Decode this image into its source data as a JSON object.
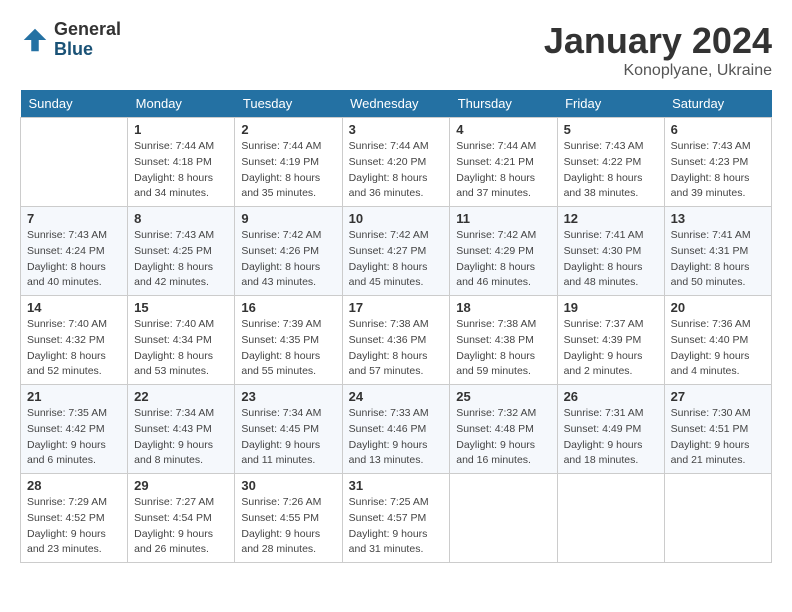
{
  "logo": {
    "general": "General",
    "blue": "Blue"
  },
  "title": {
    "month": "January 2024",
    "location": "Konoplyane, Ukraine"
  },
  "weekdays": [
    "Sunday",
    "Monday",
    "Tuesday",
    "Wednesday",
    "Thursday",
    "Friday",
    "Saturday"
  ],
  "weeks": [
    [
      {
        "day": "",
        "sunrise": "",
        "sunset": "",
        "daylight": ""
      },
      {
        "day": "1",
        "sunrise": "Sunrise: 7:44 AM",
        "sunset": "Sunset: 4:18 PM",
        "daylight": "Daylight: 8 hours and 34 minutes."
      },
      {
        "day": "2",
        "sunrise": "Sunrise: 7:44 AM",
        "sunset": "Sunset: 4:19 PM",
        "daylight": "Daylight: 8 hours and 35 minutes."
      },
      {
        "day": "3",
        "sunrise": "Sunrise: 7:44 AM",
        "sunset": "Sunset: 4:20 PM",
        "daylight": "Daylight: 8 hours and 36 minutes."
      },
      {
        "day": "4",
        "sunrise": "Sunrise: 7:44 AM",
        "sunset": "Sunset: 4:21 PM",
        "daylight": "Daylight: 8 hours and 37 minutes."
      },
      {
        "day": "5",
        "sunrise": "Sunrise: 7:43 AM",
        "sunset": "Sunset: 4:22 PM",
        "daylight": "Daylight: 8 hours and 38 minutes."
      },
      {
        "day": "6",
        "sunrise": "Sunrise: 7:43 AM",
        "sunset": "Sunset: 4:23 PM",
        "daylight": "Daylight: 8 hours and 39 minutes."
      }
    ],
    [
      {
        "day": "7",
        "sunrise": "Sunrise: 7:43 AM",
        "sunset": "Sunset: 4:24 PM",
        "daylight": "Daylight: 8 hours and 40 minutes."
      },
      {
        "day": "8",
        "sunrise": "Sunrise: 7:43 AM",
        "sunset": "Sunset: 4:25 PM",
        "daylight": "Daylight: 8 hours and 42 minutes."
      },
      {
        "day": "9",
        "sunrise": "Sunrise: 7:42 AM",
        "sunset": "Sunset: 4:26 PM",
        "daylight": "Daylight: 8 hours and 43 minutes."
      },
      {
        "day": "10",
        "sunrise": "Sunrise: 7:42 AM",
        "sunset": "Sunset: 4:27 PM",
        "daylight": "Daylight: 8 hours and 45 minutes."
      },
      {
        "day": "11",
        "sunrise": "Sunrise: 7:42 AM",
        "sunset": "Sunset: 4:29 PM",
        "daylight": "Daylight: 8 hours and 46 minutes."
      },
      {
        "day": "12",
        "sunrise": "Sunrise: 7:41 AM",
        "sunset": "Sunset: 4:30 PM",
        "daylight": "Daylight: 8 hours and 48 minutes."
      },
      {
        "day": "13",
        "sunrise": "Sunrise: 7:41 AM",
        "sunset": "Sunset: 4:31 PM",
        "daylight": "Daylight: 8 hours and 50 minutes."
      }
    ],
    [
      {
        "day": "14",
        "sunrise": "Sunrise: 7:40 AM",
        "sunset": "Sunset: 4:32 PM",
        "daylight": "Daylight: 8 hours and 52 minutes."
      },
      {
        "day": "15",
        "sunrise": "Sunrise: 7:40 AM",
        "sunset": "Sunset: 4:34 PM",
        "daylight": "Daylight: 8 hours and 53 minutes."
      },
      {
        "day": "16",
        "sunrise": "Sunrise: 7:39 AM",
        "sunset": "Sunset: 4:35 PM",
        "daylight": "Daylight: 8 hours and 55 minutes."
      },
      {
        "day": "17",
        "sunrise": "Sunrise: 7:38 AM",
        "sunset": "Sunset: 4:36 PM",
        "daylight": "Daylight: 8 hours and 57 minutes."
      },
      {
        "day": "18",
        "sunrise": "Sunrise: 7:38 AM",
        "sunset": "Sunset: 4:38 PM",
        "daylight": "Daylight: 8 hours and 59 minutes."
      },
      {
        "day": "19",
        "sunrise": "Sunrise: 7:37 AM",
        "sunset": "Sunset: 4:39 PM",
        "daylight": "Daylight: 9 hours and 2 minutes."
      },
      {
        "day": "20",
        "sunrise": "Sunrise: 7:36 AM",
        "sunset": "Sunset: 4:40 PM",
        "daylight": "Daylight: 9 hours and 4 minutes."
      }
    ],
    [
      {
        "day": "21",
        "sunrise": "Sunrise: 7:35 AM",
        "sunset": "Sunset: 4:42 PM",
        "daylight": "Daylight: 9 hours and 6 minutes."
      },
      {
        "day": "22",
        "sunrise": "Sunrise: 7:34 AM",
        "sunset": "Sunset: 4:43 PM",
        "daylight": "Daylight: 9 hours and 8 minutes."
      },
      {
        "day": "23",
        "sunrise": "Sunrise: 7:34 AM",
        "sunset": "Sunset: 4:45 PM",
        "daylight": "Daylight: 9 hours and 11 minutes."
      },
      {
        "day": "24",
        "sunrise": "Sunrise: 7:33 AM",
        "sunset": "Sunset: 4:46 PM",
        "daylight": "Daylight: 9 hours and 13 minutes."
      },
      {
        "day": "25",
        "sunrise": "Sunrise: 7:32 AM",
        "sunset": "Sunset: 4:48 PM",
        "daylight": "Daylight: 9 hours and 16 minutes."
      },
      {
        "day": "26",
        "sunrise": "Sunrise: 7:31 AM",
        "sunset": "Sunset: 4:49 PM",
        "daylight": "Daylight: 9 hours and 18 minutes."
      },
      {
        "day": "27",
        "sunrise": "Sunrise: 7:30 AM",
        "sunset": "Sunset: 4:51 PM",
        "daylight": "Daylight: 9 hours and 21 minutes."
      }
    ],
    [
      {
        "day": "28",
        "sunrise": "Sunrise: 7:29 AM",
        "sunset": "Sunset: 4:52 PM",
        "daylight": "Daylight: 9 hours and 23 minutes."
      },
      {
        "day": "29",
        "sunrise": "Sunrise: 7:27 AM",
        "sunset": "Sunset: 4:54 PM",
        "daylight": "Daylight: 9 hours and 26 minutes."
      },
      {
        "day": "30",
        "sunrise": "Sunrise: 7:26 AM",
        "sunset": "Sunset: 4:55 PM",
        "daylight": "Daylight: 9 hours and 28 minutes."
      },
      {
        "day": "31",
        "sunrise": "Sunrise: 7:25 AM",
        "sunset": "Sunset: 4:57 PM",
        "daylight": "Daylight: 9 hours and 31 minutes."
      },
      {
        "day": "",
        "sunrise": "",
        "sunset": "",
        "daylight": ""
      },
      {
        "day": "",
        "sunrise": "",
        "sunset": "",
        "daylight": ""
      },
      {
        "day": "",
        "sunrise": "",
        "sunset": "",
        "daylight": ""
      }
    ]
  ]
}
